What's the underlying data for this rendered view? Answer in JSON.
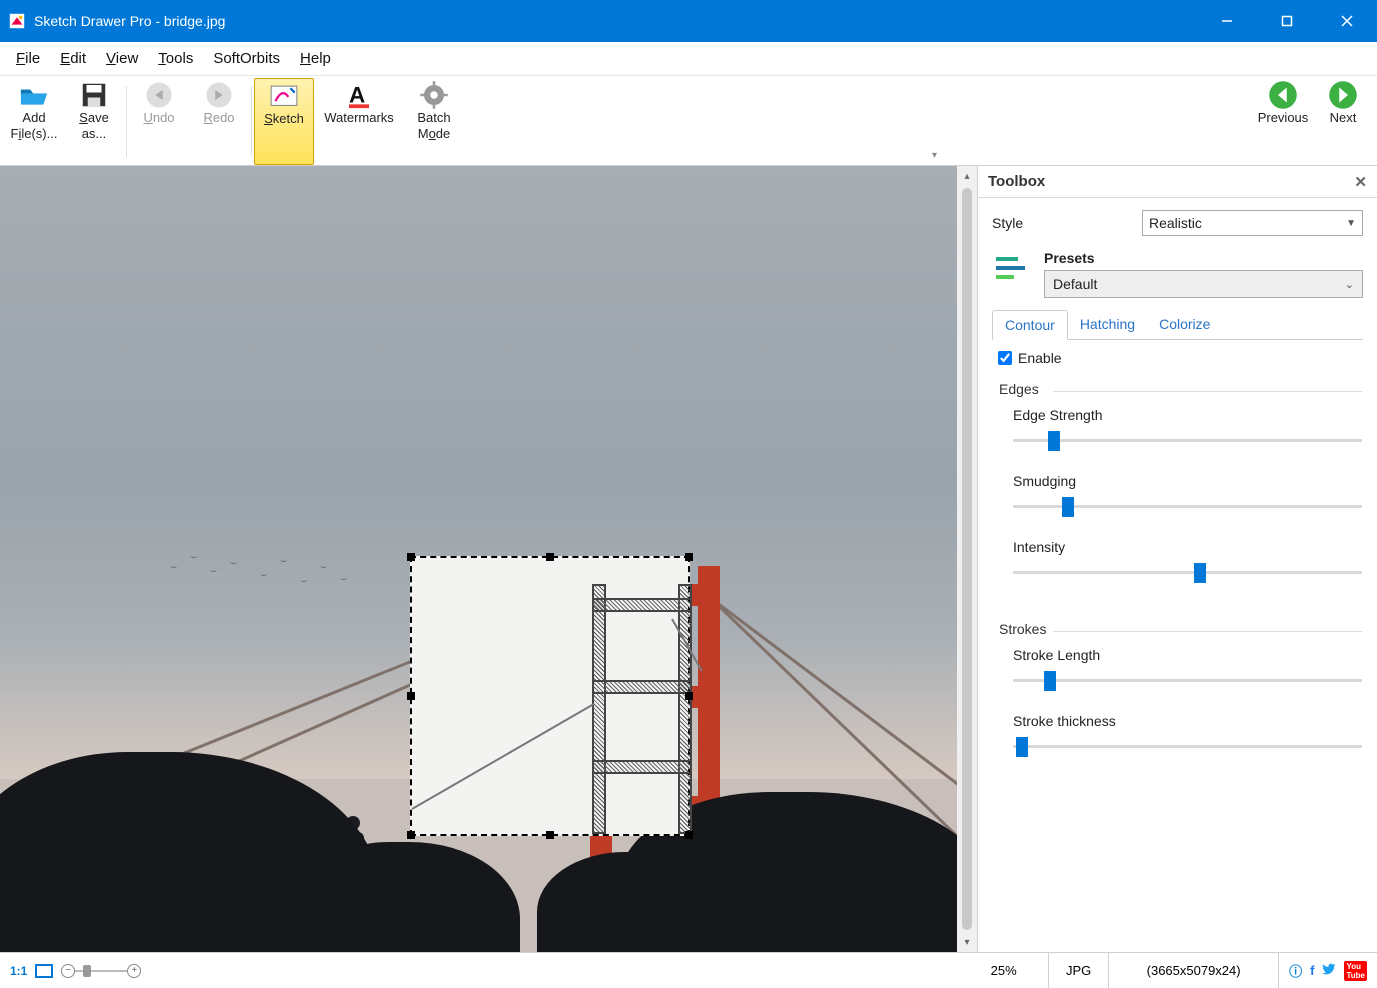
{
  "window": {
    "title": "Sketch Drawer Pro - bridge.jpg"
  },
  "menu": {
    "file": "File",
    "edit": "Edit",
    "view": "View",
    "tools": "Tools",
    "softorbits": "SoftOrbits",
    "help": "Help"
  },
  "toolbar": {
    "add_files": "Add File(s)...",
    "save_as": "Save as...",
    "undo": "Undo",
    "redo": "Redo",
    "sketch": "Sketch",
    "watermarks": "Watermarks",
    "batch_mode": "Batch Mode",
    "previous": "Previous",
    "next": "Next"
  },
  "toolbox": {
    "title": "Toolbox",
    "style_label": "Style",
    "style_value": "Realistic",
    "presets_label": "Presets",
    "preset_value": "Default",
    "tabs": {
      "contour": "Contour",
      "hatching": "Hatching",
      "colorize": "Colorize"
    },
    "enable_label": "Enable",
    "group_edges": "Edges",
    "group_strokes": "Strokes",
    "sliders": {
      "edge_strength": {
        "label": "Edge Strength",
        "pct": 10
      },
      "smudging": {
        "label": "Smudging",
        "pct": 14
      },
      "intensity": {
        "label": "Intensity",
        "pct": 52
      },
      "stroke_length": {
        "label": "Stroke Length",
        "pct": 9
      },
      "stroke_thickness": {
        "label": "Stroke thickness",
        "pct": 1
      }
    }
  },
  "status": {
    "one_to_one": "1:1",
    "zoom_value": "25",
    "zoom_percent": "%",
    "format": "JPG",
    "dims": "(3665x5079x24)"
  }
}
